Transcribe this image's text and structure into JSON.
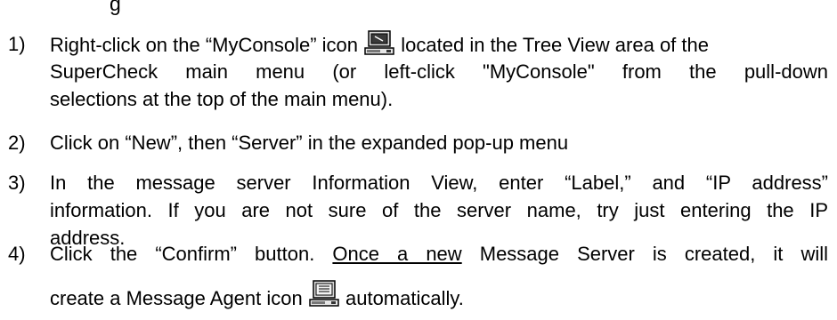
{
  "doc": {
    "title_fragment": "g",
    "steps": [
      {
        "num": "1)",
        "l1a": "Right-click on the “MyConsole” icon",
        "icon": "console-computer-icon",
        "l1b": "located in the Tree View area of the",
        "l2": "SuperCheck main menu (or left-click \"MyConsole\" from the pull-down",
        "l3": "selections at the top of the main menu)."
      },
      {
        "num": "2)",
        "l1": "Click on “New”, then “Server” in the expanded pop-up menu"
      },
      {
        "num": "3)",
        "l1": "In the message server Information View, enter “Label,” and “IP address”",
        "l2": "information. If you are not sure of the server name, try just entering the IP",
        "l3": "address."
      },
      {
        "num": "4)",
        "l1a": "Click the “Confirm” button.",
        "l1u": "Once a new",
        "l1b": "Message Server is created, it will",
        "l2a": "create a Message Agent icon",
        "icon": "message-agent-computer-icon",
        "l2b": "automatically."
      }
    ]
  }
}
